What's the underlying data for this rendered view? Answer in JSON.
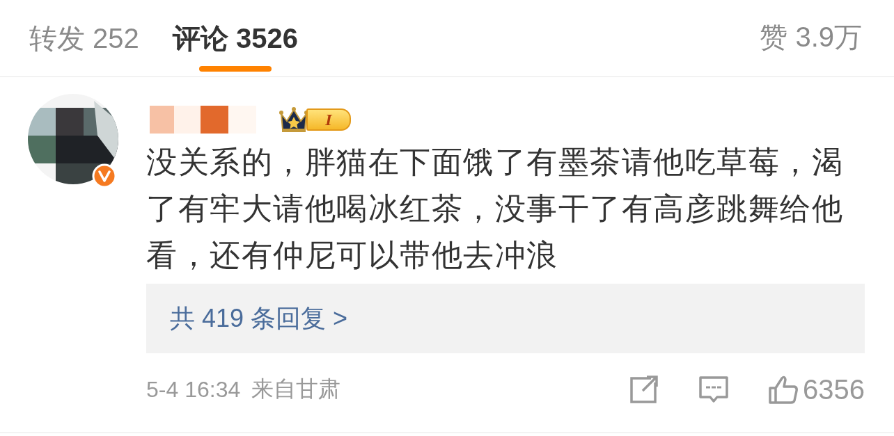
{
  "tabs": [
    {
      "label": "转发 252",
      "selected": false
    },
    {
      "label": "评论 3526",
      "selected": true
    }
  ],
  "likes": "赞 3.9万",
  "comment": {
    "avatar": {
      "verified": true
    },
    "level_badge": "I",
    "text": "没关系的，胖猫在下面饿了有墨茶请他吃草莓，渴了有牢大请他喝冰红茶，没事干了有高彦跳舞给他看，还有仲尼可以带他去冲浪",
    "replies": "共 419 条回复 >",
    "time": "5-4 16:34",
    "location": "来自甘肃",
    "like_count": "6356"
  }
}
